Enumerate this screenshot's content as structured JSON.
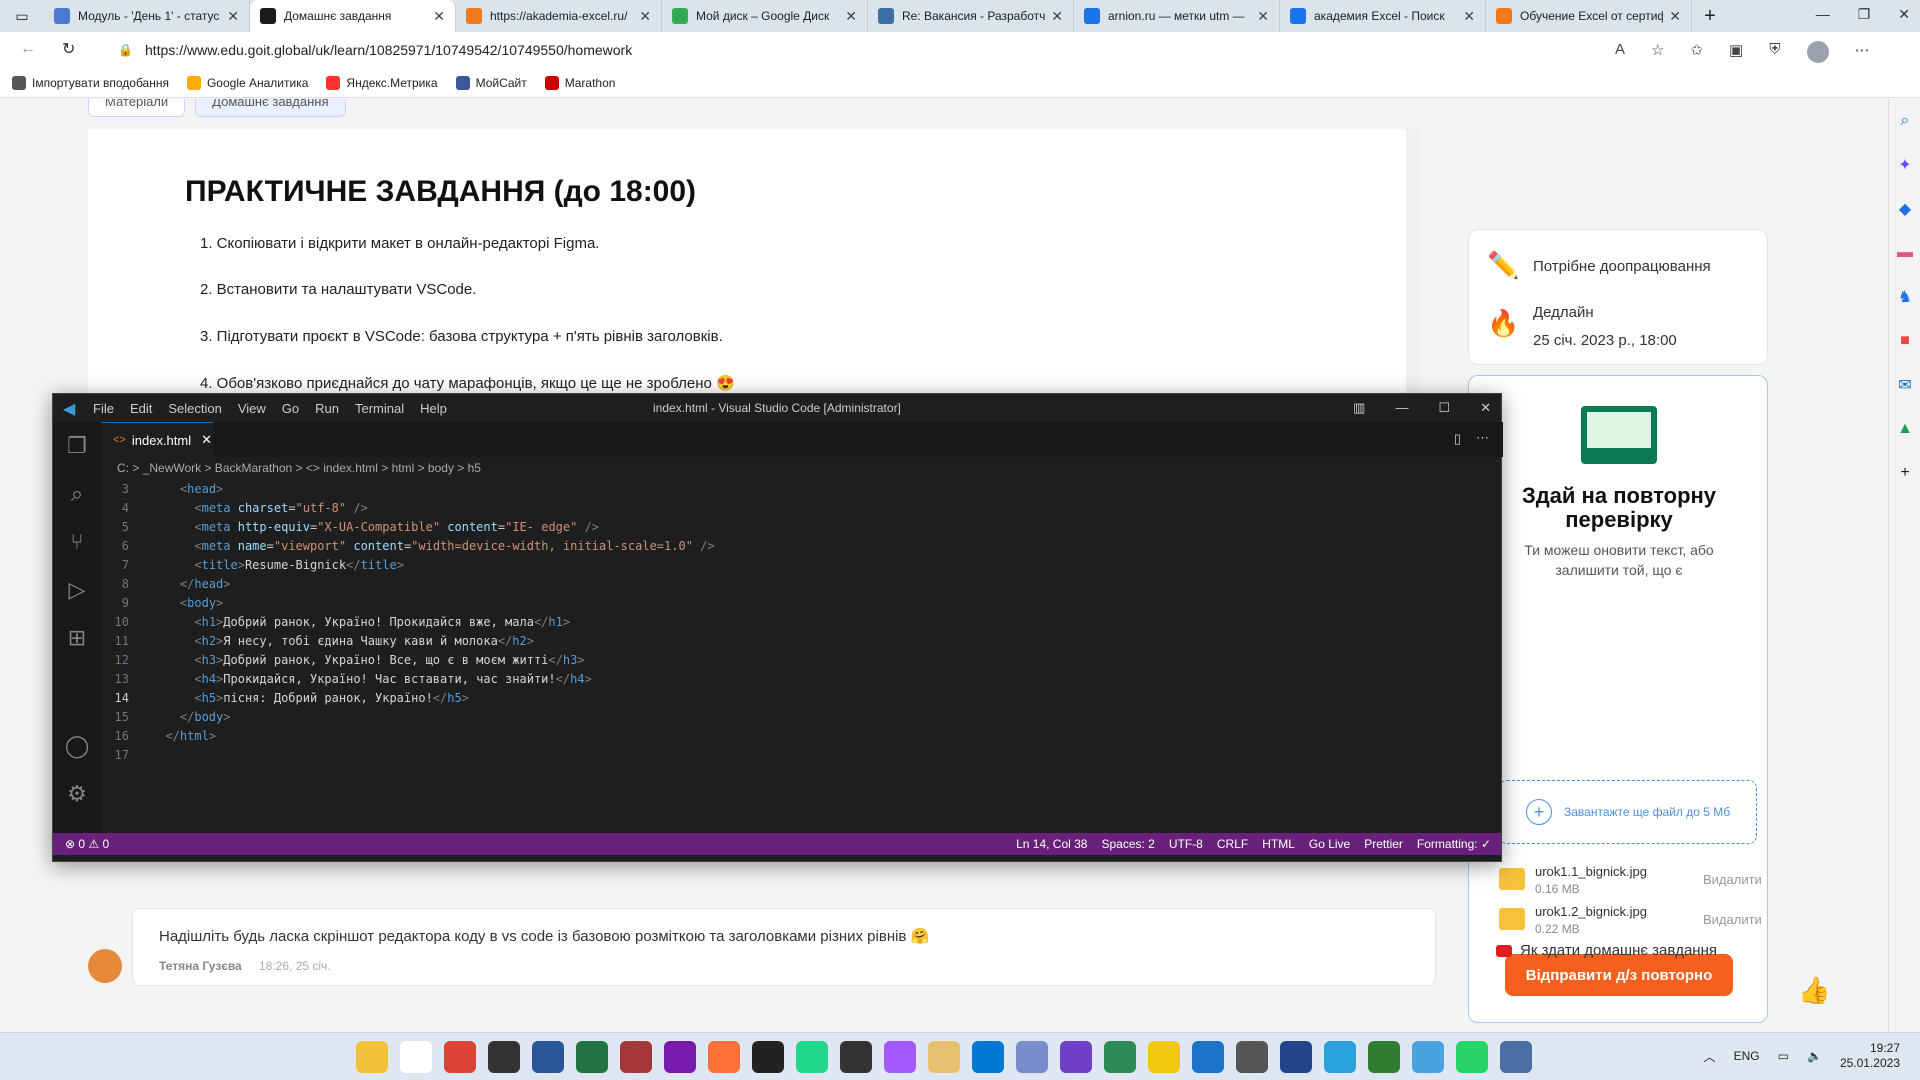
{
  "browser": {
    "tabs": [
      {
        "label": "Модуль - 'День 1' - статус",
        "color": "#4a7bd1"
      },
      {
        "label": "Домашнє завдання",
        "color": "#1a1a1a",
        "active": true
      },
      {
        "label": "https://akademia-excel.ru/",
        "color": "#f27a1a"
      },
      {
        "label": "Мой диск – Google Диск",
        "color": "#34a853"
      },
      {
        "label": "Re: Вакансия - Разработчи",
        "color": "#3a6ea5"
      },
      {
        "label": "arnion.ru — метки utm —",
        "color": "#1a73e8"
      },
      {
        "label": "академия Excel - Поиск",
        "color": "#1a73e8"
      },
      {
        "label": "Обучение Excel от сертиф",
        "color": "#f27a1a"
      }
    ],
    "url": "https://www.edu.goit.global/uk/learn/10825971/10749542/10749550/homework",
    "bookmarks": [
      {
        "label": "Імпортувати вподобання",
        "color": "#555"
      },
      {
        "label": "Google Аналитика",
        "color": "#f9ab00"
      },
      {
        "label": "Яндекс.Метрика",
        "color": "#ff3333"
      },
      {
        "label": "МойСайт",
        "color": "#3b5998"
      },
      {
        "label": "Marathon",
        "color": "#c00"
      }
    ]
  },
  "page": {
    "top_tabs": [
      "Матеріали",
      "Домашнє завдання"
    ],
    "title": "ПРАКТИЧНЕ ЗАВДАННЯ (до 18:00)",
    "items": [
      "1. Скопіювати і відкрити макет в онлайн-редакторі Figma.",
      "2. Встановити та налаштувати VSCode.",
      "3. Підготувати проєкт в VSCode: базова структура + п'ять рівнів заголовків.",
      "4. Обов'язково приєднайся до чату марафонців, якщо це ще не зроблено 😍"
    ],
    "status": "Потрібне доопрацювання",
    "deadline_label": "Дедлайн",
    "deadline_value": "25 січ. 2023 р., 18:00",
    "resubmit_title": "Здай на повторну перевірку",
    "resubmit_sub": "Ти можеш оновити текст, або залишити той, що є",
    "upload_label": "Завантажте ще файл до 5 Мб",
    "files": [
      {
        "name": "urok1.1_bignick.jpg",
        "size": "0.16 MB",
        "action": "Видалити"
      },
      {
        "name": "urok1.2_bignick.jpg",
        "size": "0.22 MB",
        "action": "Видалити"
      }
    ],
    "submit_label": "Відправити д/з повторно",
    "howto_label": "Як здати домашнє завдання",
    "comment_text": "Надішліть будь ласка скріншот редактора коду в vs code із базовою розміткою та заголовками різних рівнів 🤗",
    "comment_author": "Тетяна Гузєва",
    "comment_time": "18:26, 25 січ."
  },
  "vscode": {
    "menu": [
      "File",
      "Edit",
      "Selection",
      "View",
      "Go",
      "Run",
      "Terminal",
      "Help"
    ],
    "window_title": "index.html - Visual Studio Code [Administrator]",
    "tab": "index.html",
    "breadcrumb": "C: > _NewWork > BackMarathon > <> index.html > html > body > h5",
    "lines": [
      {
        "n": "3",
        "code": "    <head>"
      },
      {
        "n": "4",
        "code": "      <meta charset=\"utf-8\" />"
      },
      {
        "n": "5",
        "code": "      <meta http-equiv=\"X-UA-Compatible\" content=\"IE- edge\" />"
      },
      {
        "n": "6",
        "code": "      <meta name=\"viewport\" content=\"width=device-width, initial-scale=1.0\" />"
      },
      {
        "n": "7",
        "code": "      <title>Resume-Bignick</title>"
      },
      {
        "n": "8",
        "code": "    </head>"
      },
      {
        "n": "9",
        "code": "    <body>"
      },
      {
        "n": "10",
        "code": "      <h1>Добрий ранок, Україно! Прокидайся вже, мала</h1>"
      },
      {
        "n": "11",
        "code": "      <h2>Я несу, тобі єдина Чашку кави й молока</h2>"
      },
      {
        "n": "12",
        "code": "      <h3>Добрий ранок, Україно! Все, що є в моєм житті</h3>"
      },
      {
        "n": "13",
        "code": "      <h4>Прокидайся, Україно! Час вставати, час знайти!</h4>"
      },
      {
        "n": "14",
        "code": "      <h5>пісня: Добрий ранок, Україно!</h5>",
        "current": true
      },
      {
        "n": "15",
        "code": "    </body>"
      },
      {
        "n": "16",
        "code": "  </html>"
      },
      {
        "n": "17",
        "code": ""
      }
    ],
    "status_left": "⊗ 0 ⚠ 0",
    "status_right": [
      "Ln 14, Col 38",
      "Spaces: 2",
      "UTF-8",
      "CRLF",
      "HTML",
      "Go Live",
      "Prettier",
      "Formatting: ✓"
    ]
  },
  "taskbar": {
    "lang": "ENG",
    "time": "19:27",
    "date": "25.01.2023"
  }
}
